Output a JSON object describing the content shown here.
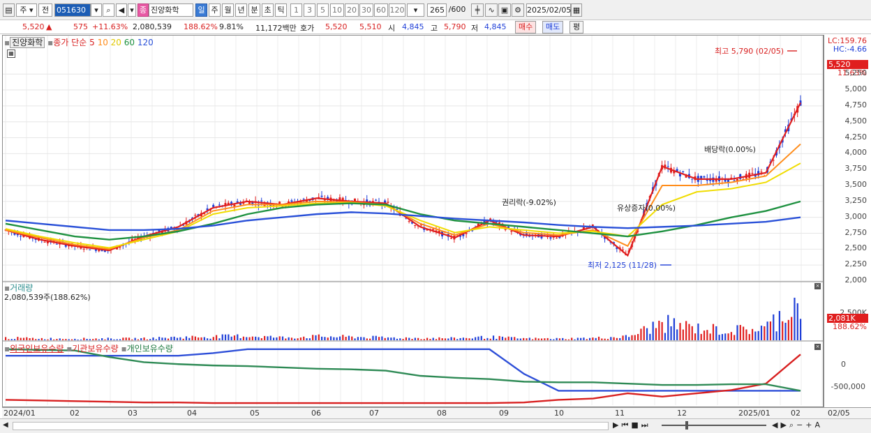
{
  "toolbar": {
    "market": "주",
    "prev": "전",
    "code": "051630",
    "stock_badge": "종",
    "stock_name": "진양화학",
    "periods": [
      "일",
      "주",
      "월",
      "년",
      "분",
      "초",
      "틱"
    ],
    "active_period": "일",
    "intervals": [
      "1",
      "3",
      "5",
      "10",
      "20",
      "30",
      "60",
      "120"
    ],
    "count": "265",
    "count_total": "/600",
    "date": "2025/02/05"
  },
  "quote": {
    "price": "5,520",
    "arrow": "▲",
    "change": "575",
    "change_pct": "+11.63%",
    "volume": "2,080,539",
    "vol_ratio": "188.62%",
    "turnover": "9.81%",
    "amount": "11,172백만",
    "ask_label": "호가",
    "ask": "5,520",
    "bid": "5,510",
    "open_label": "시",
    "open": "4,845",
    "high_label": "고",
    "high": "5,790",
    "low_label": "저",
    "low": "4,845",
    "buy_label": "매수",
    "sell_label": "매도",
    "avg_label": "평"
  },
  "price_panel": {
    "stock_label": "진양화학",
    "ma_title": "종가 단순",
    "ma_periods": [
      "5",
      "10",
      "20",
      "60",
      "120"
    ],
    "high_annot": "최고 5,790 (02/05)",
    "low_annot": "최저 2,125 (11/28)",
    "events": [
      "권리락(-9.02%)",
      "유상증자(0.00%)",
      "배당락(0.00%)"
    ],
    "lc_label": "LC:159.76",
    "hc_label": "HC:-4.66",
    "price_box": "5,520",
    "pct_label": "11.63%",
    "yticks": [
      "5,250",
      "5,000",
      "4,750",
      "4,500",
      "4,250",
      "4,000",
      "3,750",
      "3,500",
      "3,250",
      "3,000",
      "2,750",
      "2,500",
      "2,250",
      "2,000"
    ]
  },
  "volume_panel": {
    "title": "거래량",
    "value": "2,080,539주(188.62%)",
    "axis_label": "2,500K",
    "vol_box": "2,081K",
    "vol_pct": "188.62%"
  },
  "holdings_panel": {
    "series": [
      "외국인보유수량",
      "기관보유수량",
      "개인보유수량"
    ],
    "yticks": [
      "0",
      "-500,000"
    ]
  },
  "x_axis": {
    "labels": [
      "2024/01",
      "02",
      "03",
      "04",
      "05",
      "06",
      "07",
      "08",
      "09",
      "10",
      "11",
      "12",
      "2025/01",
      "02"
    ],
    "right_label": "02/05"
  },
  "colors": {
    "up": "#e01e1e",
    "down": "#1f3fd8",
    "ma5": "#e01e1e",
    "ma10": "#ff8c1a",
    "ma20": "#f0dc00",
    "ma60": "#1e9140",
    "ma120": "#2950d8"
  },
  "chart_data": [
    {
      "type": "candlestick",
      "title": "진양화학",
      "ylim": [
        2000,
        5800
      ],
      "series": [
        {
          "name": "5",
          "values": [
            2800,
            2650,
            2550,
            2480,
            2700,
            2850,
            3150,
            3250,
            3200,
            3300,
            3250,
            3220,
            2850,
            2680,
            2950,
            2720,
            2700,
            2850,
            2400,
            3800,
            3600,
            3600,
            3700,
            4800
          ]
        },
        {
          "name": "10",
          "values": [
            2800,
            2680,
            2570,
            2500,
            2680,
            2800,
            3100,
            3200,
            3200,
            3250,
            3240,
            3200,
            2900,
            2720,
            2900,
            2760,
            2720,
            2800,
            2550,
            3500,
            3500,
            3550,
            3650,
            4150
          ]
        },
        {
          "name": "20",
          "values": [
            2820,
            2700,
            2600,
            2520,
            2650,
            2780,
            3050,
            3150,
            3180,
            3220,
            3230,
            3180,
            2950,
            2760,
            2850,
            2800,
            2750,
            2780,
            2700,
            3200,
            3400,
            3450,
            3550,
            3850
          ]
        },
        {
          "name": "60",
          "values": [
            2900,
            2800,
            2700,
            2650,
            2700,
            2780,
            2900,
            3050,
            3150,
            3200,
            3220,
            3200,
            3050,
            2950,
            2900,
            2850,
            2800,
            2750,
            2700,
            2780,
            2880,
            3000,
            3100,
            3250
          ]
        },
        {
          "name": "120",
          "values": [
            2950,
            2900,
            2850,
            2800,
            2800,
            2820,
            2870,
            2950,
            3000,
            3050,
            3080,
            3060,
            3020,
            2980,
            2950,
            2920,
            2880,
            2850,
            2830,
            2850,
            2870,
            2900,
            2930,
            3000
          ]
        }
      ]
    },
    {
      "type": "bar",
      "title": "거래량",
      "values_k": [
        120,
        90,
        80,
        85,
        90,
        150,
        180,
        220,
        140,
        190,
        170,
        130,
        110,
        100,
        160,
        90,
        80,
        110,
        180,
        850,
        600,
        480,
        620,
        2081
      ]
    },
    {
      "type": "line",
      "title": "보유수량",
      "series": [
        {
          "name": "외국인보유수량",
          "values": [
            -20000,
            -20000,
            -20000,
            -20000,
            -20000,
            -20000,
            20000,
            80000,
            80000,
            80000,
            80000,
            80000,
            80000,
            80000,
            80000,
            -300000,
            -560000,
            -560000,
            -560000,
            -560000,
            -560000,
            -560000,
            -560000,
            -560000
          ]
        },
        {
          "name": "기관보유수량",
          "values": [
            -700000,
            -710000,
            -720000,
            -730000,
            -740000,
            -740000,
            -750000,
            -750000,
            -750000,
            -750000,
            -750000,
            -750000,
            -750000,
            -750000,
            -750000,
            -740000,
            -700000,
            -680000,
            -600000,
            -650000,
            -600000,
            -550000,
            -450000,
            0
          ]
        },
        {
          "name": "개인보유수량",
          "values": [
            80000,
            70000,
            60000,
            -40000,
            -120000,
            -150000,
            -170000,
            -180000,
            -200000,
            -220000,
            -230000,
            -250000,
            -330000,
            -360000,
            -380000,
            -420000,
            -430000,
            -430000,
            -450000,
            -470000,
            -470000,
            -460000,
            -460000,
            -560000
          ]
        }
      ]
    }
  ]
}
